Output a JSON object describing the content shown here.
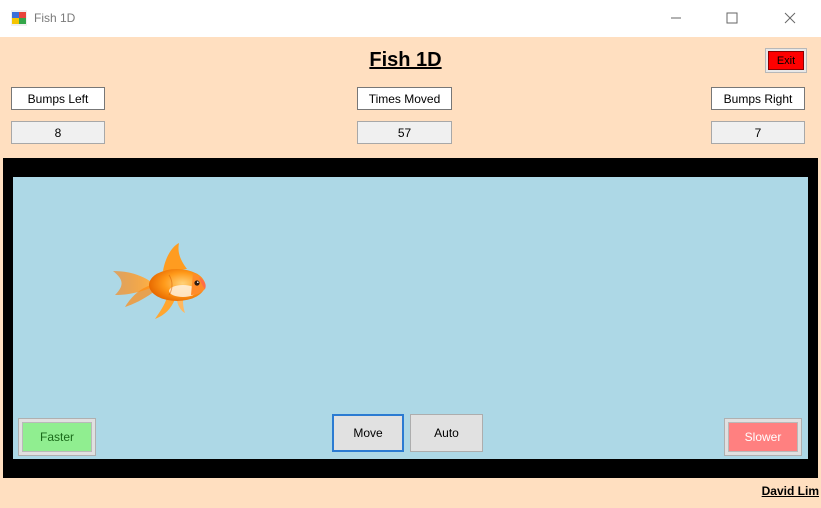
{
  "window": {
    "title": "Fish 1D",
    "icon": "winforms-app-icon",
    "controls": [
      "minimize-icon",
      "maximize-icon",
      "close-icon"
    ]
  },
  "form": {
    "heading": "Fish 1D",
    "exit_label": "Exit",
    "background": "#ffdfc0"
  },
  "counters": {
    "bumps_left_label": "Bumps Left",
    "bumps_left_value": "8",
    "times_moved_label": "Times Moved",
    "times_moved_value": "57",
    "bumps_right_label": "Bumps Right",
    "bumps_right_value": "7"
  },
  "tank": {
    "frame_color": "#000000",
    "water_color": "#add8e6",
    "fish_icon": "goldfish-image"
  },
  "controls": {
    "faster_label": "Faster",
    "faster_color": "#90ee90",
    "move_label": "Move",
    "auto_label": "Auto",
    "slower_label": "Slower",
    "slower_color": "#ff8080",
    "exit_color": "#ff0000"
  },
  "footer": {
    "author": "David Lim"
  }
}
